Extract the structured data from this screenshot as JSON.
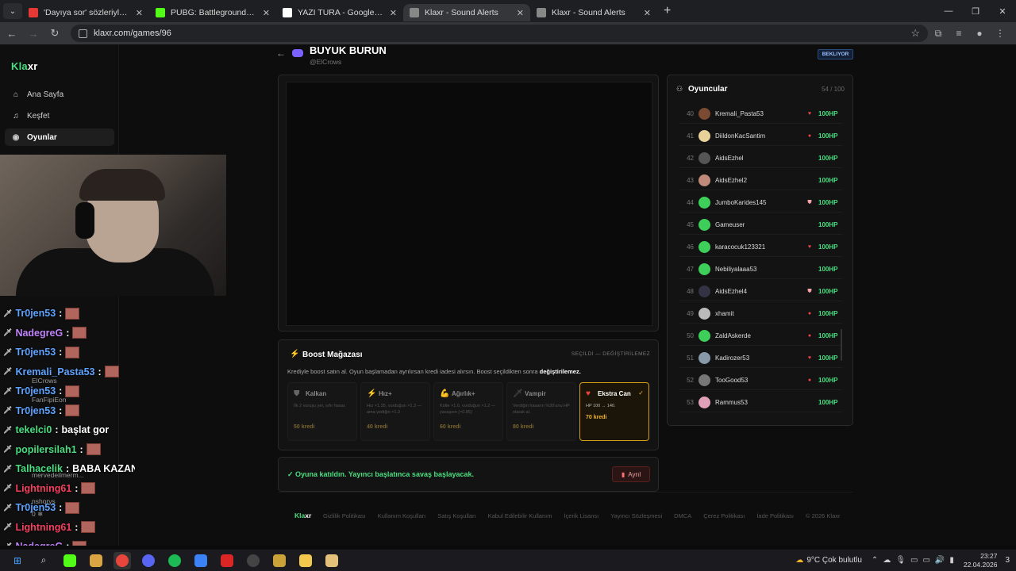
{
  "browser": {
    "tabs": [
      {
        "title": "'Dayıya sor' sözleriyle fenomen",
        "favicon_color": "#e53935",
        "active": false
      },
      {
        "title": "PUBG: Battlegrounds Streaming",
        "favicon_color": "#53fc18",
        "active": false
      },
      {
        "title": "YAZI TURA - Google Search",
        "favicon_color": "#ffffff",
        "active": false
      },
      {
        "title": "Klaxr - Sound Alerts",
        "favicon_color": "#888888",
        "active": true
      },
      {
        "title": "Klaxr - Sound Alerts",
        "favicon_color": "#888888",
        "active": false
      }
    ],
    "url": "klaxr.com/games/96"
  },
  "sidebar": {
    "logo_accent": "Kla",
    "logo_rest": "xr",
    "items": [
      {
        "label": "Ana Sayfa",
        "icon": "home-icon",
        "active": false
      },
      {
        "label": "Keşfet",
        "icon": "music-icon",
        "active": false
      },
      {
        "label": "Oyunlar",
        "icon": "gamepad-icon",
        "active": true
      }
    ]
  },
  "chat": {
    "lines": [
      {
        "user": "Tr0jen53",
        "color": "#5ea3ff",
        "msg": ""
      },
      {
        "user": "NadegreG",
        "color": "#c084fc",
        "msg": ""
      },
      {
        "user": "Tr0jen53",
        "color": "#5ea3ff",
        "msg": ""
      },
      {
        "user": "Kremali_Pasta53",
        "color": "#5ea3ff",
        "msg": ""
      },
      {
        "user": "Tr0jen53",
        "color": "#5ea3ff",
        "msg": ""
      },
      {
        "user": "Tr0jen53",
        "color": "#5ea3ff",
        "msg": ""
      },
      {
        "user": "tekelci0",
        "color": "#4ade80",
        "msg": "başlat gor"
      },
      {
        "user": "popilersilah1",
        "color": "#4ade80",
        "msg": ""
      },
      {
        "user": "Talhacelik",
        "color": "#4ade80",
        "msg": "BABA KAZANDI"
      },
      {
        "user": "Lightning61",
        "color": "#f43f5e",
        "msg": ""
      },
      {
        "user": "Tr0jen53",
        "color": "#5ea3ff",
        "msg": ""
      },
      {
        "user": "Lightning61",
        "color": "#f43f5e",
        "msg": ""
      },
      {
        "user": "NadegreG",
        "color": "#c084fc",
        "msg": ""
      }
    ],
    "under": [
      "ElCrows",
      "FanFipiEon",
      "mervedeilmerm...",
      "nshorys",
      "0 ❄"
    ]
  },
  "game": {
    "title": "BUYUK BURUN",
    "host": "@ElCrows",
    "status": "BEKLIYOR"
  },
  "shop": {
    "title": "Boost Mağazası",
    "tag": "SEÇİLDİ — DEĞİŞTİRİLEMEZ",
    "desc_before": "Krediyle boost satın al. Oyun başlamadan ayrılırsan kredi iadesi alırsın. Boost seçildikten sonra",
    "desc_bold": "değiştirilemez.",
    "cards": [
      {
        "name": "Kalkan",
        "icon": "shield-icon",
        "desc": "İlk 2 vuruşu yer, sıfır hasar.",
        "price": "50 kredi",
        "selected": false
      },
      {
        "name": "Hız+",
        "icon": "bolt-icon",
        "desc": "Hız ×1.35, vurduğun ×1.3 — ama yediğin ×1.3",
        "price": "40 kredi",
        "selected": false
      },
      {
        "name": "Ağırlık+",
        "icon": "muscle-icon",
        "desc": "Kütle ×1.6, vurduğun ×1.2 — yavaşsın (×0.85)",
        "price": "60 kredi",
        "selected": false
      },
      {
        "name": "Vampir",
        "icon": "vampire-icon",
        "desc": "Verdiğin hasarın %30'unu HP olarak al.",
        "price": "80 kredi",
        "selected": false
      },
      {
        "name": "Ekstra Can",
        "icon": "heart-icon",
        "desc": "HP 100 → 140.",
        "price": "70 kredi",
        "selected": true
      }
    ]
  },
  "joined": {
    "msg": "✓ Oyuna katıldın. Yayıncı başlatınca savaş başlayacak.",
    "leave": "Ayrıl"
  },
  "players": {
    "title": "Oyuncular",
    "count": "54 / 100",
    "rows": [
      {
        "num": "40",
        "name": "Kremali_Pasta53",
        "hp": "100HP",
        "boost": "heart",
        "avatar": "#7a4a32"
      },
      {
        "num": "41",
        "name": "DiildonKacSantim",
        "hp": "100HP",
        "boost": "dot",
        "avatar": "#e8d29a"
      },
      {
        "num": "42",
        "name": "AidsEzhel",
        "hp": "100HP",
        "boost": "",
        "avatar": "#555555"
      },
      {
        "num": "43",
        "name": "AidsEzhel2",
        "hp": "100HP",
        "boost": "",
        "avatar": "#c08a7a"
      },
      {
        "num": "44",
        "name": "JumboKarides145",
        "hp": "100HP",
        "boost": "shield",
        "avatar": "#3ecf5a"
      },
      {
        "num": "45",
        "name": "Gameuser",
        "hp": "100HP",
        "boost": "",
        "avatar": "#3ecf5a"
      },
      {
        "num": "46",
        "name": "karacocuk123321",
        "hp": "100HP",
        "boost": "heart",
        "avatar": "#3ecf5a"
      },
      {
        "num": "47",
        "name": "Nebiliyalaaa53",
        "hp": "100HP",
        "boost": "",
        "avatar": "#3ecf5a"
      },
      {
        "num": "48",
        "name": "AidsEzhel4",
        "hp": "100HP",
        "boost": "shield",
        "avatar": "#333344"
      },
      {
        "num": "49",
        "name": "xhamit",
        "hp": "100HP",
        "boost": "dot",
        "avatar": "#bbbbbb"
      },
      {
        "num": "50",
        "name": "ZaldAskerde",
        "hp": "100HP",
        "boost": "dot",
        "avatar": "#3ecf5a"
      },
      {
        "num": "51",
        "name": "Kadirozer53",
        "hp": "100HP",
        "boost": "heart",
        "avatar": "#8899aa"
      },
      {
        "num": "52",
        "name": "TooGood53",
        "hp": "100HP",
        "boost": "dot",
        "avatar": "#777777"
      },
      {
        "num": "53",
        "name": "Rammus53",
        "hp": "100HP",
        "boost": "",
        "avatar": "#e0a0b8"
      }
    ]
  },
  "footer": {
    "logo_accent": "Kla",
    "logo_rest": "xr",
    "links": [
      "Gizlilik Politikası",
      "Kullanım Koşulları",
      "Satış Koşulları",
      "Kabul Edilebilir Kullanım",
      "İçerik Lisansı",
      "Yayıncı Sözleşmesi",
      "DMCA",
      "Çerez Politikası",
      "İade Politikası",
      "© 2026 Klaxr"
    ]
  },
  "taskbar": {
    "weather": "9°C  Çok bulutlu",
    "time": "23:27",
    "date": "22.04.2026",
    "notif": "3"
  },
  "colors": {
    "accent_green": "#4ade80",
    "gold": "#f0b429",
    "danger": "#ef4444"
  }
}
